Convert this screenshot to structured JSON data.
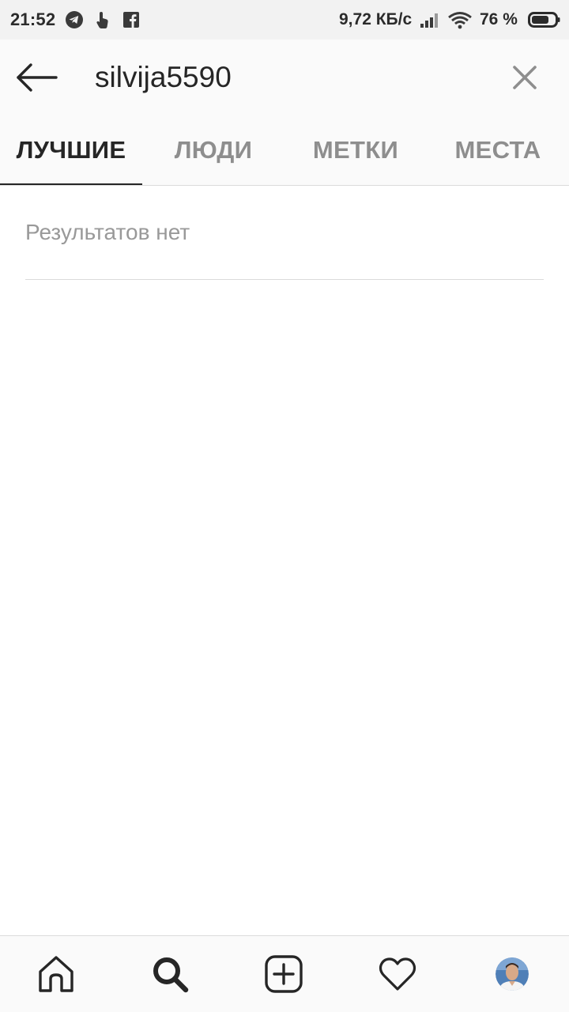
{
  "status_bar": {
    "time": "21:52",
    "icons": [
      "telegram-icon",
      "touch-icon",
      "facebook-icon"
    ],
    "network_speed": "9,72 КБ/с",
    "battery_percent": "76 %",
    "battery_level": 0.76
  },
  "search": {
    "query": "silvija5590"
  },
  "tabs": [
    {
      "label": "ЛУЧШИЕ",
      "active": true
    },
    {
      "label": "ЛЮДИ",
      "active": false
    },
    {
      "label": "МЕТКИ",
      "active": false
    },
    {
      "label": "МЕСТА",
      "active": false
    }
  ],
  "results": {
    "empty_message": "Результатов нет"
  },
  "bottom_nav": {
    "items": [
      "home-icon",
      "search-icon",
      "add-post-icon",
      "activity-heart-icon",
      "profile-avatar"
    ],
    "active": "search-icon"
  },
  "colors": {
    "text_primary": "#262626",
    "text_secondary": "#8e8e8e",
    "divider": "#dbdbdb",
    "bar_background": "#fafafa"
  }
}
